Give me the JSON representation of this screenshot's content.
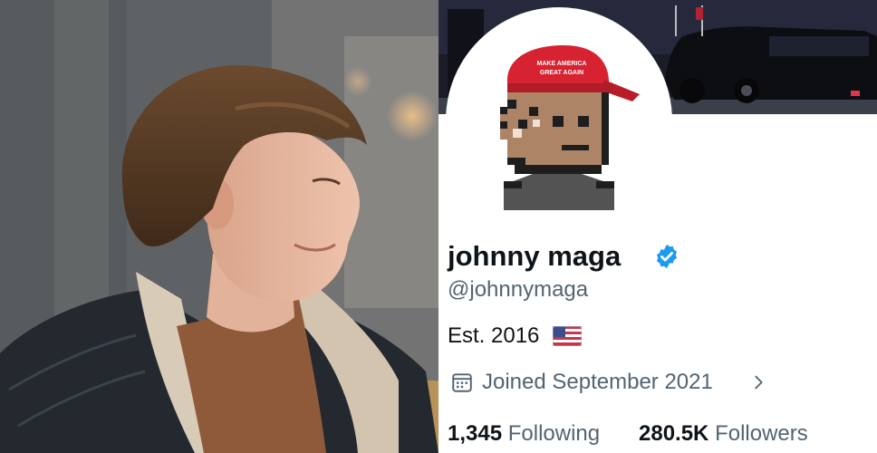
{
  "profile": {
    "display_name": "johnny maga",
    "handle": "@johnnymaga",
    "bio": "Est. 2016",
    "joined": "Joined September 2021",
    "following_count": "1,345",
    "following_label": "Following",
    "followers_count": "280.5K",
    "followers_label": "Followers",
    "verified": true,
    "bio_flag": "us-flag-icon",
    "accent_color": "#1d9bf0",
    "text_color": "#0f1419",
    "secondary_text_color": "#536471"
  },
  "icons": {
    "verified": "verified-badge-icon",
    "calendar": "calendar-icon",
    "chevron": "chevron-right-icon"
  }
}
